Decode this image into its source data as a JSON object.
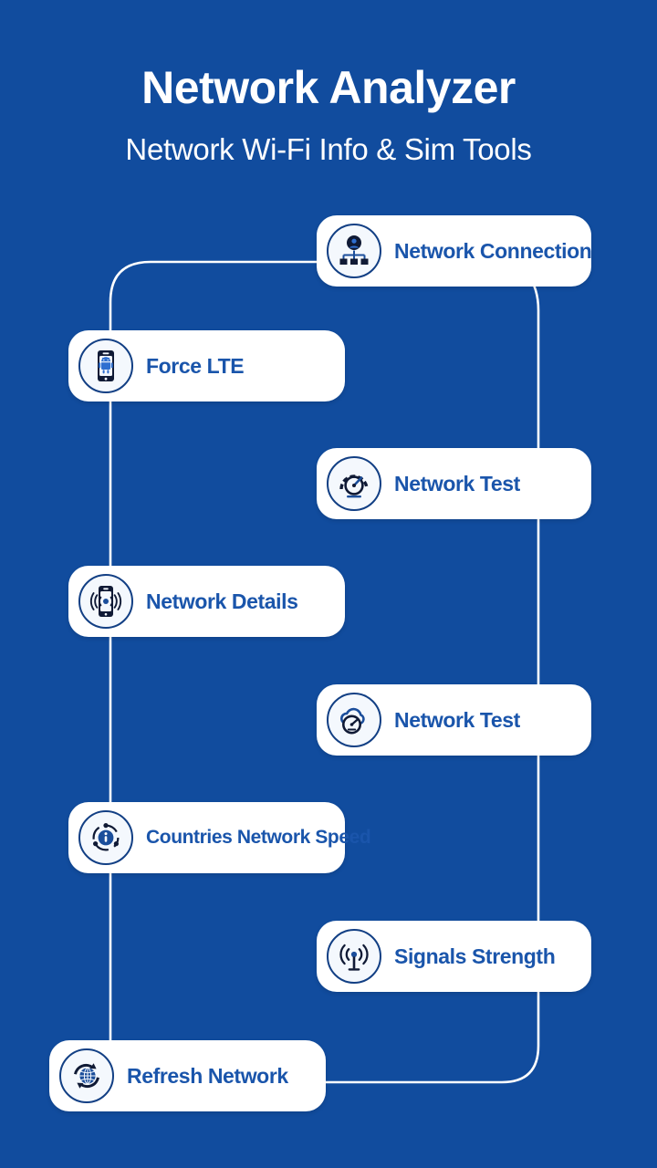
{
  "header": {
    "title": "Network Analyzer",
    "subtitle": "Network Wi-Fi Info & Sim Tools"
  },
  "theme": {
    "background": "#114C9E",
    "card_background": "#FFFFFF",
    "label_color": "#1A55AB",
    "icon_ring_color": "#123F84",
    "icon_background": "#F4F8FD",
    "connector_color": "#FFFFFF",
    "title_color": "#FFFFFF"
  },
  "cards": [
    {
      "label": "Network Connection",
      "icon": "network-connection-icon"
    },
    {
      "label": "Force LTE",
      "icon": "force-lte-phone-android-icon"
    },
    {
      "label": "Network Test",
      "icon": "speedometer-icon"
    },
    {
      "label": "Network Details",
      "icon": "phone-signal-waves-icon"
    },
    {
      "label": "Network Test",
      "icon": "cloud-speedometer-icon"
    },
    {
      "label": "Countries Network Speed",
      "icon": "info-orbit-icon"
    },
    {
      "label": "Signals Strength",
      "icon": "antenna-broadcast-icon"
    },
    {
      "label": "Refresh Network",
      "icon": "globe-refresh-icon"
    }
  ]
}
